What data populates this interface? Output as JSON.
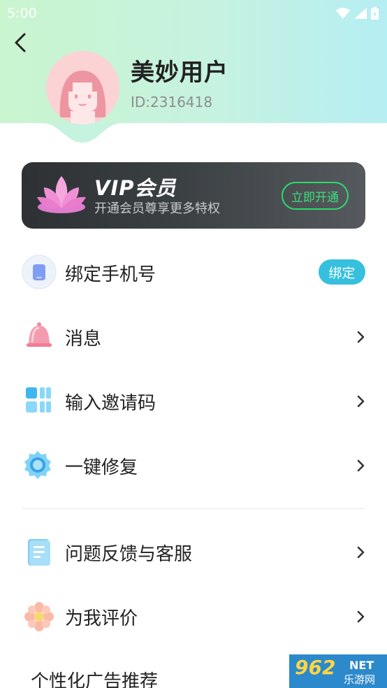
{
  "status_bar": {
    "time": "5:00"
  },
  "profile": {
    "name": "美妙用户",
    "id_text": "ID:2316418"
  },
  "vip": {
    "title": "VIP会员",
    "subtitle": "开通会员尊享更多特权",
    "button_label": "立即开通"
  },
  "menu": [
    {
      "label": "绑定手机号",
      "icon": "phone-icon",
      "badge": "绑定"
    },
    {
      "label": "消息",
      "icon": "bell-icon"
    },
    {
      "label": "输入邀请码",
      "icon": "grid-icon"
    },
    {
      "label": "一键修复",
      "icon": "gear-icon"
    },
    {
      "label": "问题反馈与客服",
      "icon": "document-icon"
    },
    {
      "label": "为我评价",
      "icon": "flower-icon"
    },
    {
      "label": "个性化广告推荐"
    }
  ],
  "watermark": {
    "brand": "962",
    "net": "NET",
    "site": "乐游网"
  },
  "colors": {
    "header_gradient_start": "#c9f5cf",
    "header_gradient_end": "#b5eef3",
    "vip_card": "#33383b",
    "vip_accent": "#2bdc6b",
    "bind_badge": "#36c0de"
  }
}
